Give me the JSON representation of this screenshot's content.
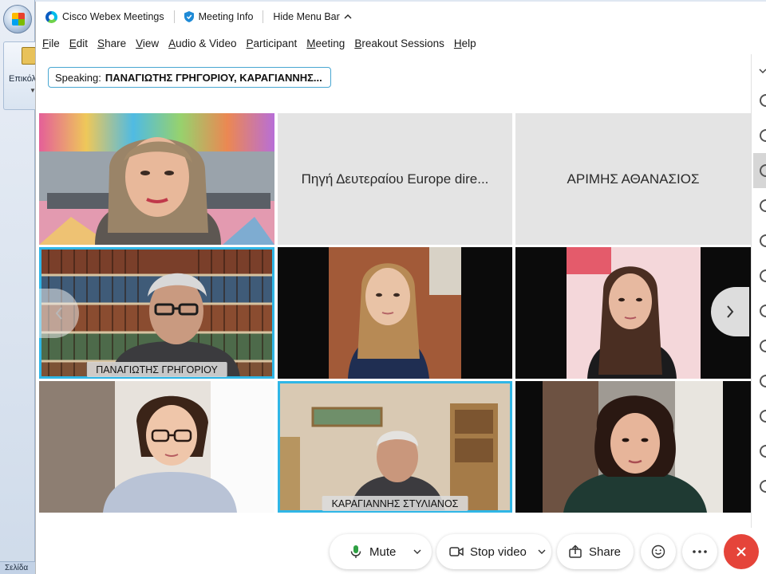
{
  "background_app": {
    "ribbon_label": "Επικόλ",
    "status_text": "Σελίδα"
  },
  "titlebar": {
    "app_name": "Cisco Webex Meetings",
    "meeting_info": "Meeting Info",
    "hide_menu": "Hide Menu Bar"
  },
  "menu": {
    "items": [
      {
        "label": "File",
        "accel": "F",
        "rest": "ile"
      },
      {
        "label": "Edit",
        "accel": "E",
        "rest": "dit"
      },
      {
        "label": "Share",
        "accel": "S",
        "rest": "hare"
      },
      {
        "label": "View",
        "accel": "V",
        "rest": "iew"
      },
      {
        "label": "Audio & Video",
        "accel": "A",
        "rest": "udio & Video"
      },
      {
        "label": "Participant",
        "accel": "P",
        "rest": "articipant"
      },
      {
        "label": "Meeting",
        "accel": "M",
        "rest": "eeting"
      },
      {
        "label": "Breakout Sessions",
        "accel": "B",
        "rest": "reakout Sessions"
      },
      {
        "label": "Help",
        "accel": "H",
        "rest": "elp"
      }
    ]
  },
  "speaking": {
    "label": "Speaking:",
    "names": "ΠΑΝΑΓΙΩΤΗΣ ΓΡΗΓΟΡΙΟΥ, ΚΑΡΑΓΙΑΝΝΗΣ..."
  },
  "tiles": [
    {
      "name": "",
      "placeholder": false,
      "active": false
    },
    {
      "name": "Πηγή Δευτεραίου Europe dire...",
      "placeholder": true,
      "active": false
    },
    {
      "name": "ΑΡΙΜΗΣ ΑΘΑΝΑΣΙΟΣ",
      "placeholder": true,
      "active": false
    },
    {
      "name": "ΠΑΝΑΓΙΩΤΗΣ ΓΡΗΓΟΡΙΟΥ",
      "placeholder": false,
      "active": true
    },
    {
      "name": "",
      "placeholder": false,
      "active": false
    },
    {
      "name": "",
      "placeholder": false,
      "active": false
    },
    {
      "name": "",
      "placeholder": false,
      "active": false
    },
    {
      "name": "ΚΑΡΑΓΙΑΝΝΗΣ ΣΤΥΛΙΑΝΟΣ",
      "placeholder": false,
      "active": true
    },
    {
      "name": "",
      "placeholder": false,
      "active": false
    }
  ],
  "controls": {
    "mute": "Mute",
    "stop_video": "Stop video",
    "share": "Share"
  },
  "icons": {
    "end_call": "close-icon",
    "more": "more-icon",
    "reactions": "smiley-icon"
  },
  "colors": {
    "active_border": "#2fb6e6",
    "end_button": "#e5443a",
    "mic_green": "#2ea043"
  }
}
